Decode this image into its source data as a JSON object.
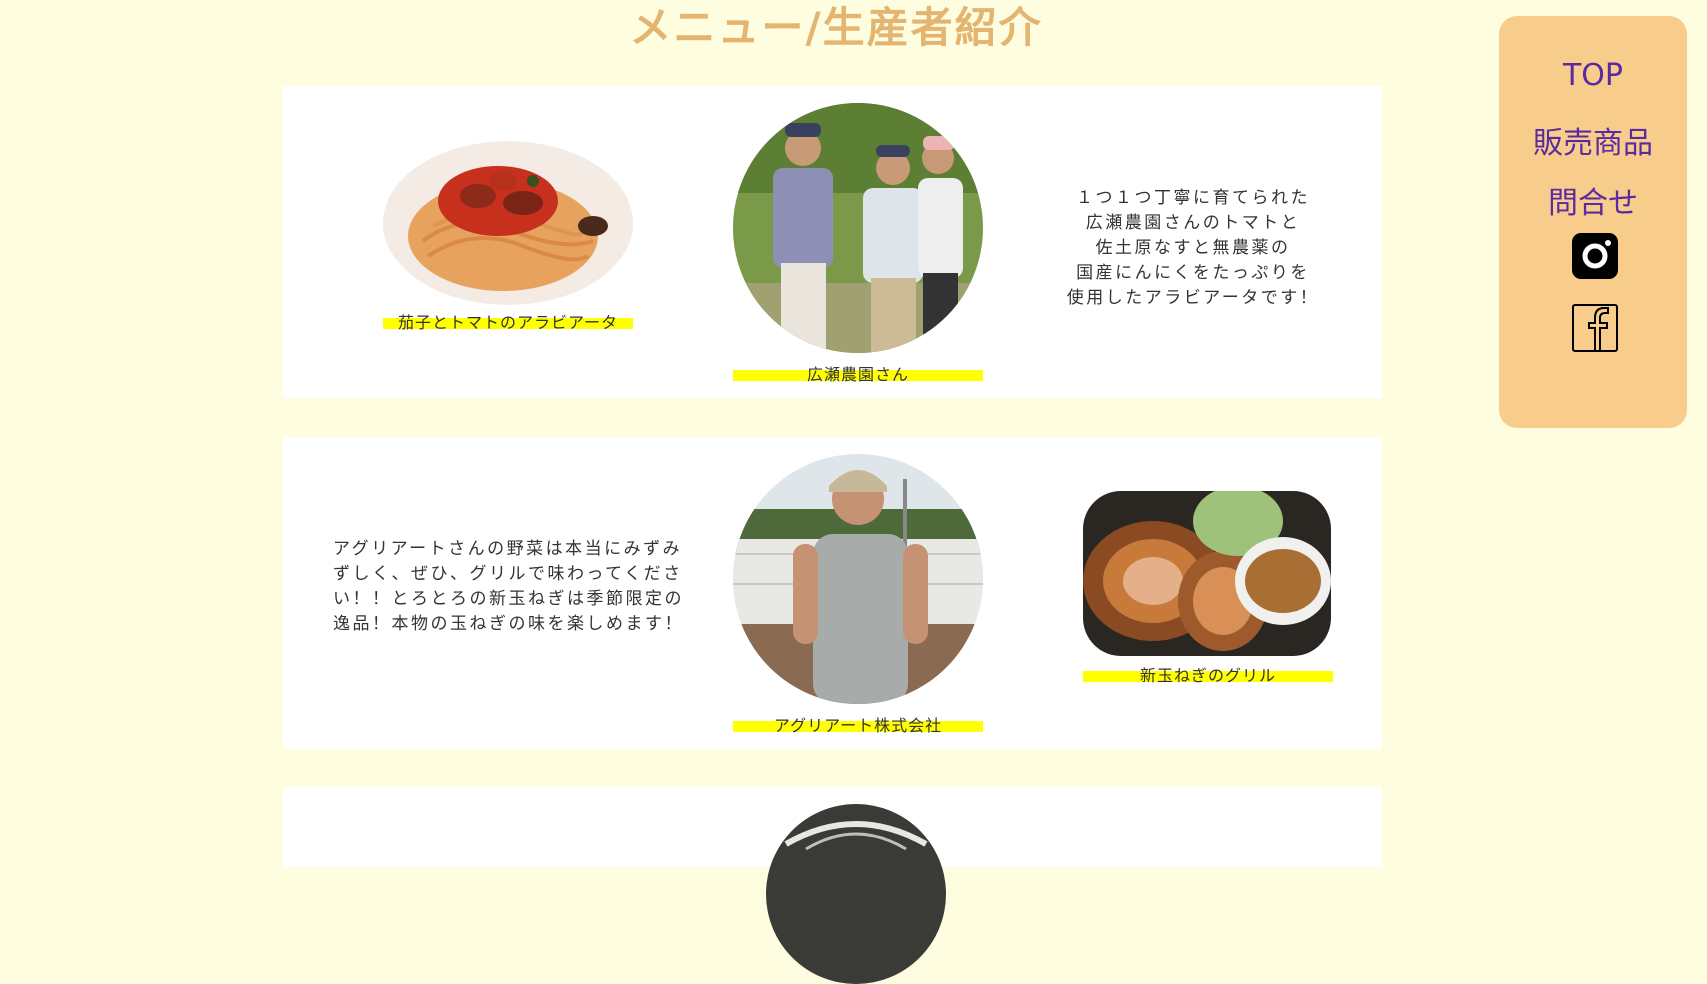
{
  "page": {
    "title": "メニュー/生産者紹介"
  },
  "sections": [
    {
      "dish_caption": "茄子とトマトのアラビアータ",
      "producer_caption": "広瀬農園さん",
      "description_lines": [
        "１つ１つ丁寧に育てられた",
        "広瀬農園さんのトマトと",
        "佐土原なすと無農薬の",
        "国産にんにくをたっぷりを",
        "使用したアラビアータです！"
      ]
    },
    {
      "description_lines": [
        "アグリアートさんの野菜は本当にみずみ",
        "ずしく、ぜひ、グリルで味わってくださ",
        "い！！とろとろの新玉ねぎは季節限定の",
        "逸品！本物の玉ねぎの味を楽しめます！"
      ],
      "producer_caption": "アグリアート株式会社",
      "dish_caption": "新玉ねぎのグリル"
    }
  ],
  "nav": {
    "top": "TOP",
    "products": "販売商品",
    "contact": "問合せ",
    "instagram_icon": "instagram-icon",
    "facebook_icon": "facebook-icon"
  },
  "colors": {
    "background": "#fffde0",
    "title": "#e3b570",
    "highlight": "#ffff00",
    "panel": "#f8cd8c",
    "nav_text": "#5a2aa0"
  }
}
